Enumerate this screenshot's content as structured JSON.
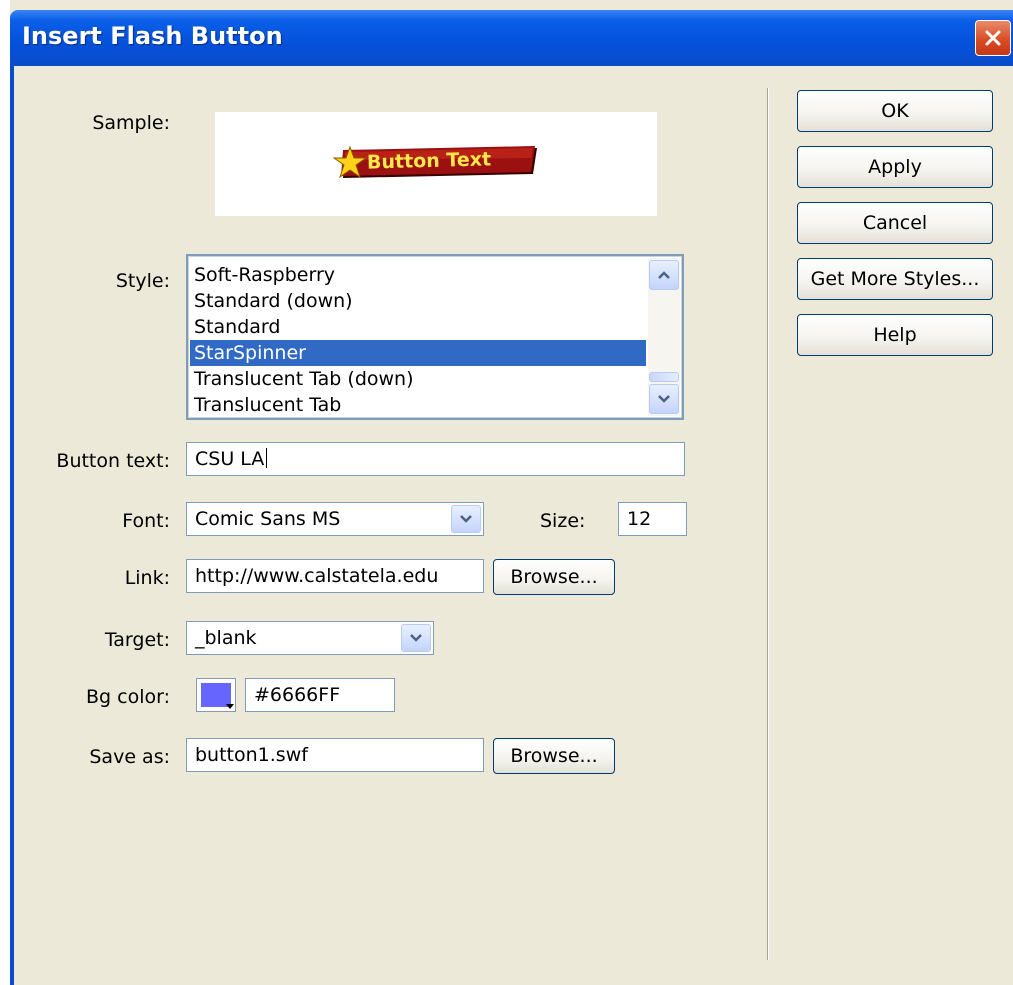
{
  "window": {
    "title": "Insert Flash Button"
  },
  "labels": {
    "sample": "Sample:",
    "style": "Style:",
    "button_text": "Button text:",
    "font": "Font:",
    "size": "Size:",
    "link": "Link:",
    "target": "Target:",
    "bg_color": "Bg color:",
    "save_as": "Save as:"
  },
  "sample": {
    "text": "Button Text"
  },
  "styles": {
    "items": [
      "Soft-Raspberry",
      "Standard (down)",
      "Standard",
      "StarSpinner",
      "Translucent Tab (down)",
      "Translucent Tab"
    ],
    "selected": "StarSpinner"
  },
  "fields": {
    "button_text": "CSU LA",
    "font": "Comic Sans MS",
    "size": "12",
    "link": "http://www.calstatela.edu",
    "target": "_blank",
    "bg_color": "#6666FF",
    "save_as": "button1.swf"
  },
  "buttons": {
    "ok": "OK",
    "apply": "Apply",
    "cancel": "Cancel",
    "get_more_styles": "Get More Styles...",
    "help": "Help",
    "browse_link": "Browse...",
    "browse_save": "Browse..."
  },
  "colors": {
    "bg_color_swatch": "#6666FF",
    "selection": "#316AC5",
    "titlebar": "#0A5FE8"
  },
  "icons": {
    "close": "close-icon",
    "scroll_up": "chevron-up-icon",
    "scroll_down": "chevron-down-icon",
    "dropdown": "chevron-down-icon",
    "star": "star-icon"
  }
}
